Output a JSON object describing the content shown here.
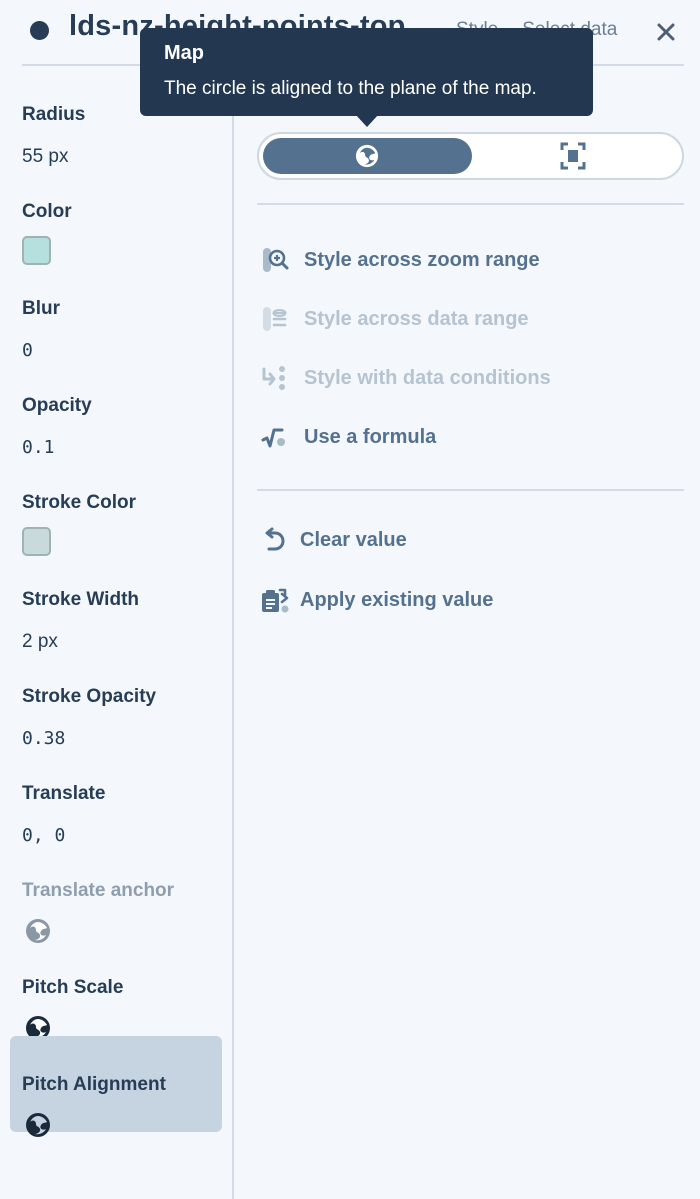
{
  "header": {
    "layer_name": "lds-nz-height-points-top",
    "tabs": [
      "Style",
      "Select data"
    ],
    "close_icon": "close-icon"
  },
  "sidebar": {
    "props": [
      {
        "label": "Radius",
        "value": "55 px",
        "kind": "text"
      },
      {
        "label": "Color",
        "value": "#b6e0de",
        "kind": "swatch"
      },
      {
        "label": "Blur",
        "value": "0",
        "kind": "mono"
      },
      {
        "label": "Opacity",
        "value": "0.1",
        "kind": "mono"
      },
      {
        "label": "Stroke Color",
        "value": "#c9dadc",
        "kind": "swatch"
      },
      {
        "label": "Stroke Width",
        "value": "2 px",
        "kind": "text"
      },
      {
        "label": "Stroke Opacity",
        "value": "0.38",
        "kind": "mono"
      },
      {
        "label": "Translate",
        "value": "0, 0",
        "kind": "mono"
      },
      {
        "label": "Translate anchor",
        "value": "globe-icon",
        "kind": "icon",
        "disabled": true
      },
      {
        "label": "Pitch Scale",
        "value": "globe-icon",
        "kind": "icon"
      },
      {
        "label": "Pitch Alignment",
        "value": "globe-icon",
        "kind": "icon",
        "selected": true
      }
    ]
  },
  "main": {
    "toggle": {
      "options": [
        "map-globe-icon",
        "viewport-icon"
      ],
      "selected": "map"
    },
    "actions": [
      {
        "label": "Style across zoom range",
        "icon": "zoom-range-icon",
        "disabled": false
      },
      {
        "label": "Style across data range",
        "icon": "data-range-icon",
        "disabled": true
      },
      {
        "label": "Style with data conditions",
        "icon": "data-conditions-icon",
        "disabled": true
      },
      {
        "label": "Use a formula",
        "icon": "formula-icon",
        "disabled": false
      }
    ],
    "value_actions": [
      {
        "label": "Clear value",
        "icon": "undo-icon"
      },
      {
        "label": "Apply existing value",
        "icon": "clipboard-icon"
      }
    ]
  },
  "tooltip": {
    "title": "Map",
    "body": "The circle is aligned to the plane of the map."
  },
  "colors": {
    "background": "#f4f7fc",
    "text": "#273d56",
    "accent": "#54728f",
    "selected_row": "#c6d4e2",
    "tooltip": "#233850"
  }
}
